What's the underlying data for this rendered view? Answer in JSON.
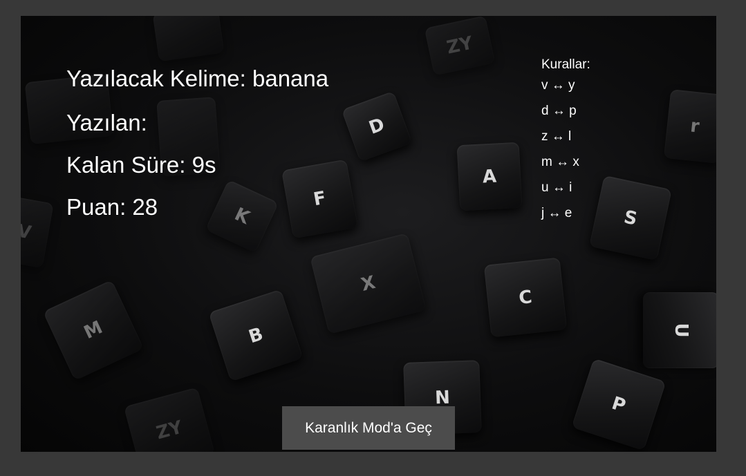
{
  "game": {
    "target_word_label": "Yazılacak Kelime: banana",
    "typed_label": "Yazılan:",
    "time_left_label": "Kalan Süre: 9s",
    "score_label": "Puan: 28"
  },
  "rules": {
    "title": "Kurallar:",
    "items": [
      "v ↔ y",
      "d ↔ p",
      "z ↔ l",
      "m ↔ x",
      "u ↔ i",
      "j ↔ e"
    ]
  },
  "mode_button": {
    "label": "Karanlık Mod'a Geç"
  },
  "background": {
    "description_icon": "keyboard-keys-background",
    "key_letters": [
      "Z",
      "Y",
      "D",
      "A",
      "F",
      "K",
      "S",
      "C",
      "X",
      "B",
      "N",
      "P",
      "M",
      "U",
      "V",
      "r",
      "Z",
      "Y"
    ]
  },
  "colors": {
    "page_bg": "#383838",
    "stage_bg": "#0d0d0e",
    "text": "#ffffff",
    "button_bg": "#4c4c4c"
  }
}
